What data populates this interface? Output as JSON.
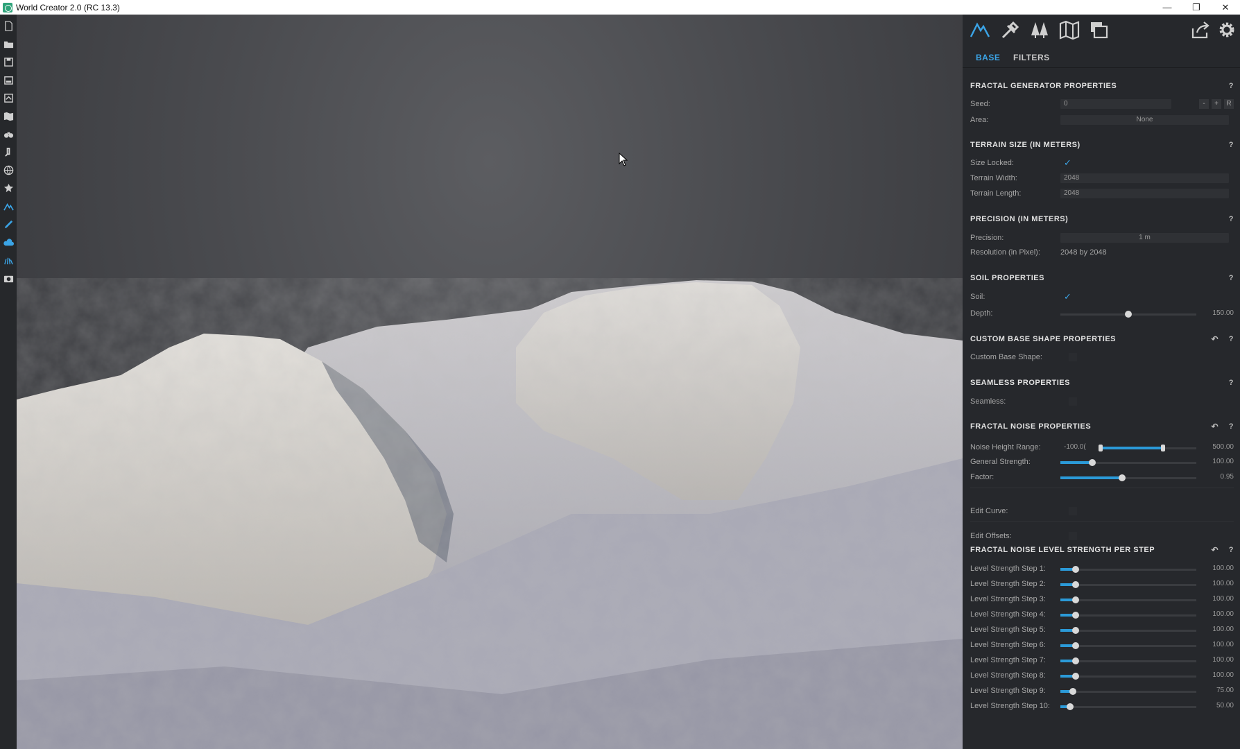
{
  "window": {
    "title": "World Creator 2.0 (RC 13.3)",
    "minimize": "—",
    "restore": "❐",
    "close": "✕"
  },
  "left_toolbar": {
    "icons": [
      "new-file-icon",
      "open-folder-icon",
      "save-icon",
      "save-as-icon",
      "import-icon",
      "map-icon",
      "binoculars-icon",
      "brush-icon",
      "globe-icon",
      "gear-flower-icon",
      "mountain-icon",
      "pen-tool-icon",
      "cloud-icon",
      "grass-icon",
      "camera-icon"
    ]
  },
  "panel": {
    "top_icons": [
      "mountain-icon",
      "tools-icon",
      "trees-icon",
      "map-icon",
      "layers-icon",
      "export-icon",
      "settings-icon"
    ],
    "tabs": {
      "base": "BASE",
      "filters": "FILTERS"
    },
    "fractal_generator": {
      "header": "FRACTAL GENERATOR PROPERTIES",
      "help": "?",
      "seed_label": "Seed:",
      "seed_value": "0",
      "seed_minus": "-",
      "seed_plus": "+",
      "seed_random": "R",
      "area_label": "Area:",
      "area_value": "None"
    },
    "terrain_size": {
      "header": "TERRAIN SIZE (IN METERS)",
      "help": "?",
      "size_locked_label": "Size Locked:",
      "size_locked": "✓",
      "width_label": "Terrain Width:",
      "width_value": "2048",
      "length_label": "Terrain Length:",
      "length_value": "2048"
    },
    "precision": {
      "header": "PRECISION (IN METERS)",
      "help": "?",
      "precision_label": "Precision:",
      "precision_value": "1 m",
      "resolution_label": "Resolution (in Pixel):",
      "resolution_value": "2048 by 2048"
    },
    "soil": {
      "header": "SOIL PROPERTIES",
      "help": "?",
      "soil_label": "Soil:",
      "soil_check": "✓",
      "depth_label": "Depth:",
      "depth_value": "150.00",
      "depth_fraction": 0.5
    },
    "custom_base": {
      "header": "CUSTOM BASE SHAPE PROPERTIES",
      "reset": "↶",
      "help": "?",
      "label": "Custom Base Shape:"
    },
    "seamless": {
      "header": "SEAMLESS PROPERTIES",
      "help": "?",
      "label": "Seamless:"
    },
    "fractal_noise": {
      "header": "FRACTAL NOISE PROPERTIES",
      "reset": "↶",
      "help": "?",
      "noise_range_label": "Noise Height Range:",
      "noise_range_min": "-100.0(",
      "noise_range_max": "500.00",
      "general_strength_label": "General Strength:",
      "general_strength_value": "100.00",
      "general_strength_fraction": 0.22,
      "factor_label": "Factor:",
      "factor_value": "0.95",
      "factor_fraction": 0.45,
      "edit_curve_label": "Edit Curve:",
      "edit_offsets_label": "Edit Offsets:"
    },
    "level_strength": {
      "header": "FRACTAL NOISE LEVEL STRENGTH PER STEP",
      "reset": "↶",
      "help": "?",
      "steps": [
        {
          "label": "Level Strength Step 1:",
          "value": "100.00",
          "fraction": 0.09
        },
        {
          "label": "Level Strength Step 2:",
          "value": "100.00",
          "fraction": 0.09
        },
        {
          "label": "Level Strength Step 3:",
          "value": "100.00",
          "fraction": 0.09
        },
        {
          "label": "Level Strength Step 4:",
          "value": "100.00",
          "fraction": 0.09
        },
        {
          "label": "Level Strength Step 5:",
          "value": "100.00",
          "fraction": 0.09
        },
        {
          "label": "Level Strength Step 6:",
          "value": "100.00",
          "fraction": 0.09
        },
        {
          "label": "Level Strength Step 7:",
          "value": "100.00",
          "fraction": 0.09
        },
        {
          "label": "Level Strength Step 8:",
          "value": "100.00",
          "fraction": 0.09
        },
        {
          "label": "Level Strength Step 9:",
          "value": "75.00",
          "fraction": 0.07
        },
        {
          "label": "Level Strength Step 10:",
          "value": "50.00",
          "fraction": 0.05
        }
      ]
    }
  },
  "colors": {
    "accent": "#3ba4e6",
    "slider_fill": "#2b9ad8",
    "panel_bg": "#26282c",
    "toolbar_bg": "#26282b"
  }
}
